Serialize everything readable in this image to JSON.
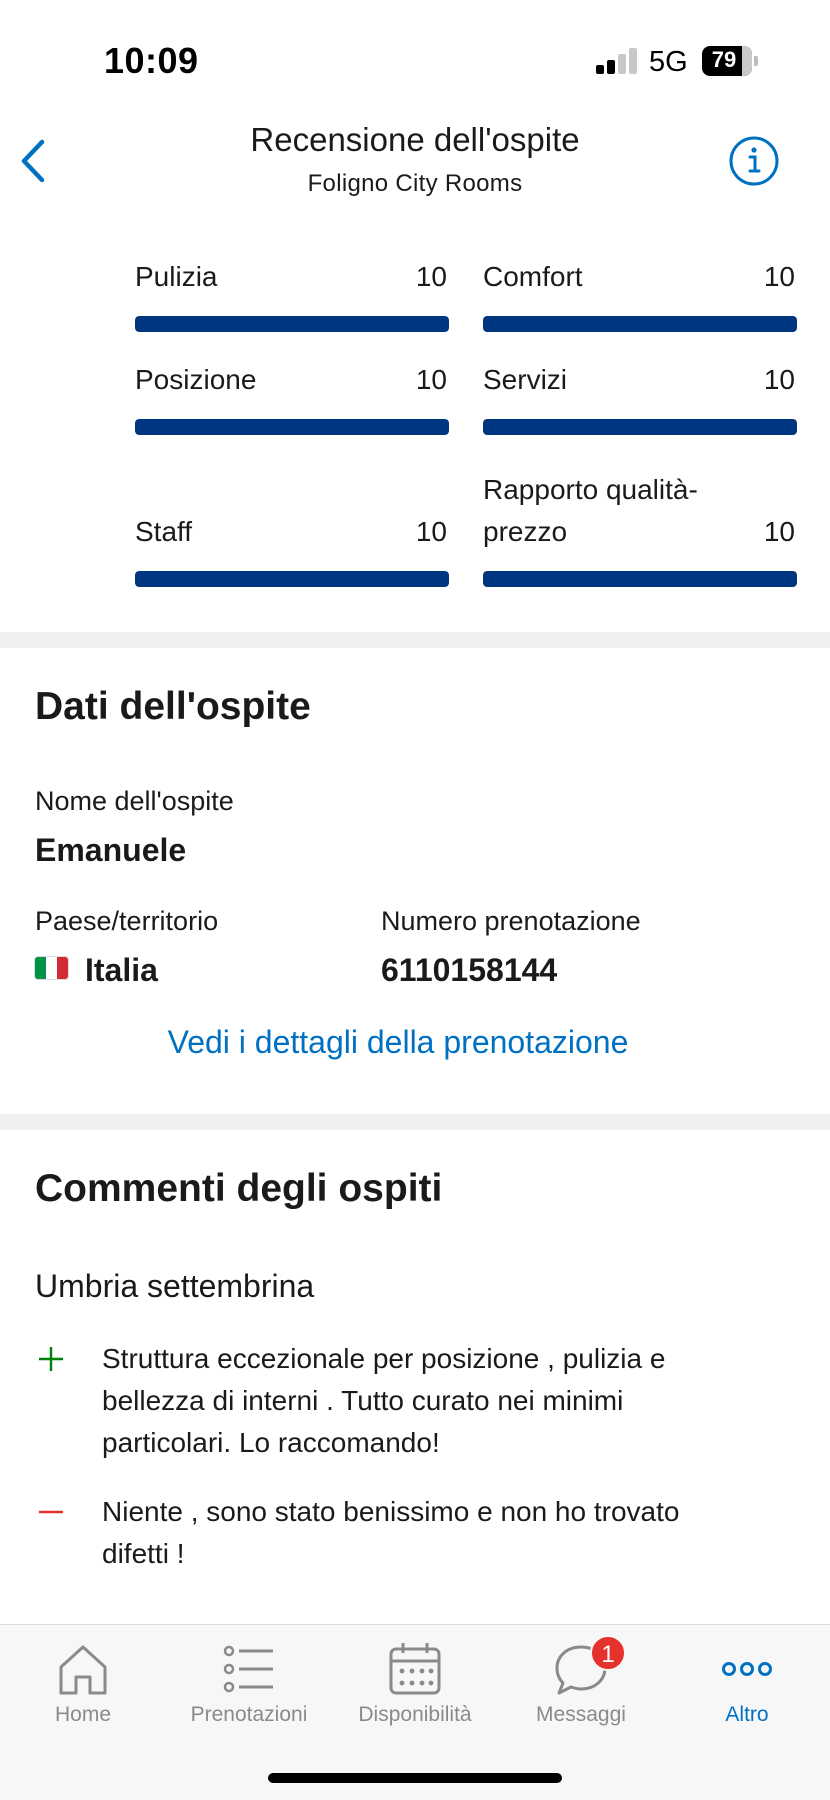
{
  "status_bar": {
    "time": "10:09",
    "network": "5G",
    "battery": "79"
  },
  "header": {
    "title": "Recensione dell'ospite",
    "subtitle": "Foligno City Rooms"
  },
  "ratings": [
    {
      "label": "Pulizia",
      "score": "10",
      "fraction": 1.0
    },
    {
      "label": "Comfort",
      "score": "10",
      "fraction": 1.0
    },
    {
      "label": "Posizione",
      "score": "10",
      "fraction": 1.0
    },
    {
      "label": "Servizi",
      "score": "10",
      "fraction": 1.0
    },
    {
      "label": "Staff",
      "score": "10",
      "fraction": 1.0
    },
    {
      "label": "Rapporto qualità-prezzo",
      "label_line1": "Rapporto qualità-",
      "label_line2": "prezzo",
      "score": "10",
      "fraction": 1.0
    }
  ],
  "guest": {
    "section_title": "Dati dell'ospite",
    "name_label": "Nome dell'ospite",
    "name_value": "Emanuele",
    "country_label": "Paese/territorio",
    "country_value": "Italia",
    "booking_label": "Numero prenotazione",
    "booking_value": "6110158144",
    "details_link": "Vedi i dettagli della prenotazione"
  },
  "comments": {
    "section_title": "Commenti degli ospiti",
    "headline": "Umbria settembrina",
    "positive_line1": "Struttura eccezionale per posizione , pulizia e",
    "positive_line2": "bellezza di interni . Tutto curato nei minimi",
    "positive_line3": "particolari. Lo raccomando!",
    "negative_line1": "Niente , sono stato benissimo e non ho trovato",
    "negative_line2": "difetti !"
  },
  "tabbar": {
    "home": "Home",
    "bookings": "Prenotazioni",
    "availability": "Disponibilità",
    "messages": "Messaggi",
    "messages_badge": "1",
    "more": "Altro"
  },
  "colors": {
    "bar": "#003580",
    "link": "#0071c2",
    "positive": "#008009",
    "negative": "#e5322d"
  }
}
